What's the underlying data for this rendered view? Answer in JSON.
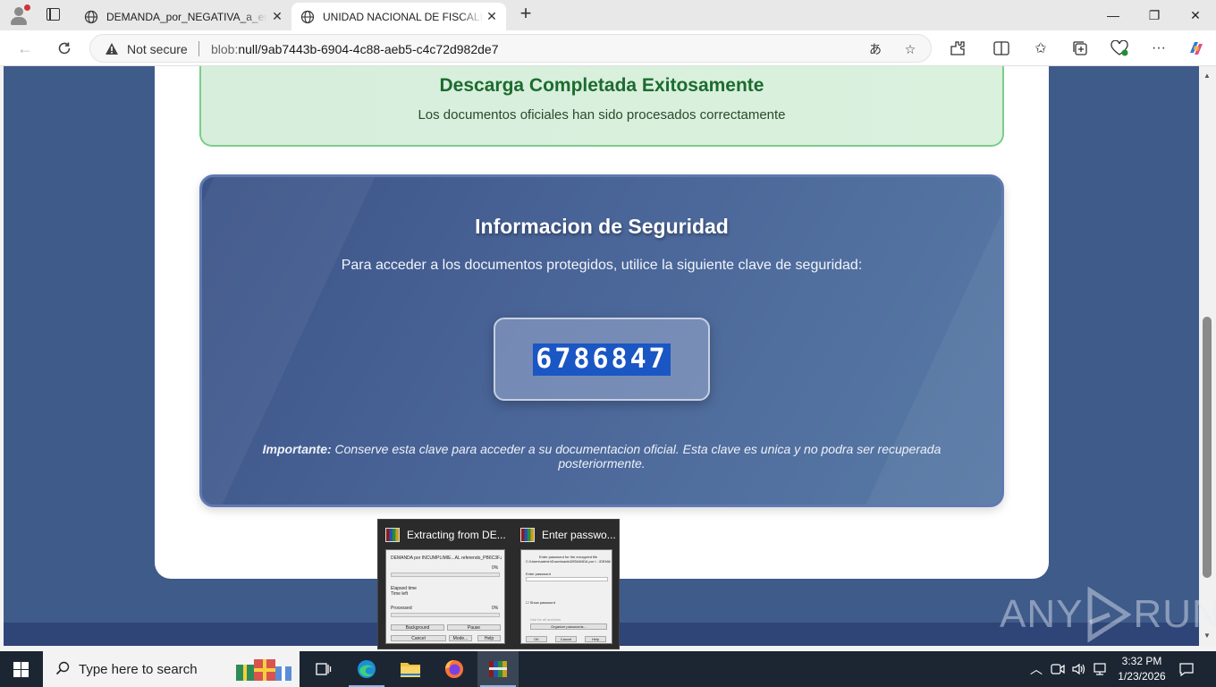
{
  "browser": {
    "tabs": [
      {
        "title": "DEMANDA_por_NEGATIVA_a_entr",
        "active": false
      },
      {
        "title": "UNIDAD NACIONAL DE FISCALIAS",
        "active": true
      }
    ],
    "security_label": "Not secure",
    "url_scheme": "blob:",
    "url_rest": "null/9ab7443b-6904-4c88-aeb5-c4c72d982de7"
  },
  "page": {
    "success_title": "Descarga Completada Exitosamente",
    "success_subtitle": "Los documentos oficiales han sido procesados correctamente",
    "security_title": "Informacion de Seguridad",
    "security_intro": "Para acceder a los documentos protegidos, utilice la siguiente clave de seguridad:",
    "security_key": "6786847",
    "note_label": "Importante:",
    "note_text": "Conserve esta clave para acceder a su documentacion oficial. Esta clave es unica y no podra ser recuperada posteriormente."
  },
  "watermark": {
    "left": "ANY",
    "right": "RUN"
  },
  "thumbnails": [
    {
      "title": "Extracting from DE...",
      "preview": {
        "file": "DEMANDA por INCUMPLIMIE...AL referendo_PB6C3F.zip",
        "pct1": "0%",
        "elapsed": "Elapsed time",
        "timeleft": "Time left",
        "processed": "Processed",
        "pct2": "0%",
        "background": "Background",
        "pause": "Pause",
        "cancel": "Cancel",
        "mode": "Mode...",
        "help": "Help"
      }
    },
    {
      "title": "Enter passwo...",
      "preview": {
        "line1": "Enter password for the encrypted file",
        "line2": "C:\\Users\\admin\\Downloads\\DEMANDA por I...\\DEMANDA.pdf",
        "field": "Enter password",
        "show": "Show password",
        "useall": "Use for all archives",
        "organize": "Organize passwords...",
        "ok": "OK",
        "cancel": "Cancel",
        "help": "Help"
      }
    }
  ],
  "taskbar": {
    "search_placeholder": "Type here to search",
    "time": "3:32 PM",
    "date": "1/23/2026"
  },
  "colors": {
    "page_bg": "#3f5b8a",
    "success_bg": "#d6eedb",
    "success_title": "#1d6b2f",
    "key_highlight": "#1a56c4"
  }
}
